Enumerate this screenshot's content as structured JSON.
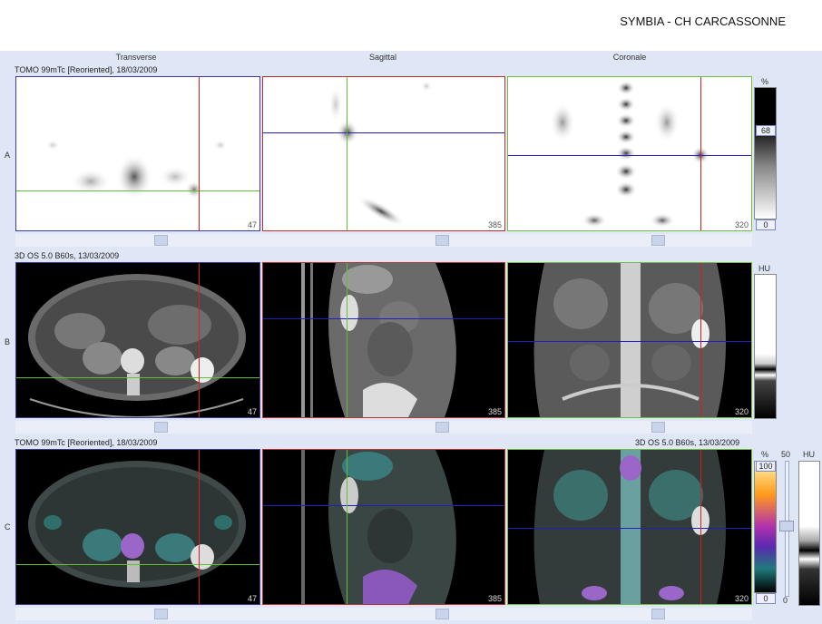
{
  "header": {
    "title": "SYMBIA - CH CARCASSONNE"
  },
  "columns": [
    "Transverse",
    "Sagittal",
    "Coronale"
  ],
  "rows": {
    "a": {
      "letter": "A",
      "caption": "TOMO 99mTc [Reoriented], 18/03/2009"
    },
    "b": {
      "letter": "B",
      "caption": "3D  OS  5.0  B60s, 13/03/2009"
    },
    "c": {
      "letter": "C",
      "caption_left": "TOMO 99mTc [Reoriented], 18/03/2009",
      "caption_right": "3D  OS  5.0  B60s, 13/03/2009"
    }
  },
  "slices": {
    "transverse": "47",
    "sagittal": "385",
    "coronal": "320"
  },
  "colorbars": {
    "a": {
      "unit": "%",
      "max": "68",
      "min": "0"
    },
    "b": {
      "unit": "HU"
    },
    "c": {
      "unit": "%",
      "max": "100",
      "min": "0",
      "blend_label": "50",
      "blend_min": "0",
      "ct_unit": "HU"
    }
  },
  "colors": {
    "transverse_frame": "#3a3aa0",
    "sagittal_frame": "#c03030",
    "coronal_frame": "#70c040",
    "crosshair_blue": "#2020c0",
    "crosshair_red": "#d02020",
    "crosshair_green": "#60c030"
  }
}
